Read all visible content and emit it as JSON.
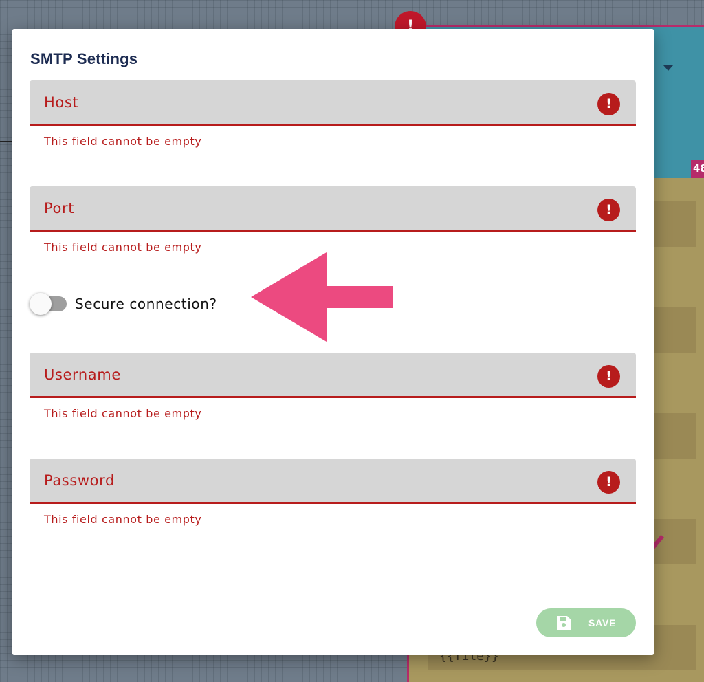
{
  "dialog": {
    "title": "SMTP Settings"
  },
  "fields": [
    {
      "label": "Host",
      "value": "",
      "error": "This field cannot be empty",
      "icon": "error-circle-icon"
    },
    {
      "label": "Port",
      "value": "",
      "error": "This field cannot be empty",
      "icon": "error-circle-icon"
    },
    {
      "label": "Username",
      "value": "",
      "error": "This field cannot be empty",
      "icon": "error-circle-icon"
    },
    {
      "label": "Password",
      "value": "",
      "error": "This field cannot be empty",
      "icon": "error-circle-icon"
    }
  ],
  "secure_toggle": {
    "label": "Secure connection?",
    "checked": false
  },
  "save_button": {
    "label": "SAVE",
    "icon": "floppy-disk-icon",
    "enabled": false
  },
  "background": {
    "badge": "48",
    "text": "{{file}}"
  },
  "colors": {
    "error": "#b71c1c",
    "title": "#1d2c52",
    "save_button": "#a5d6a7",
    "field_background": "#d6d6d6",
    "annotation_arrow": "#ec4a80"
  }
}
